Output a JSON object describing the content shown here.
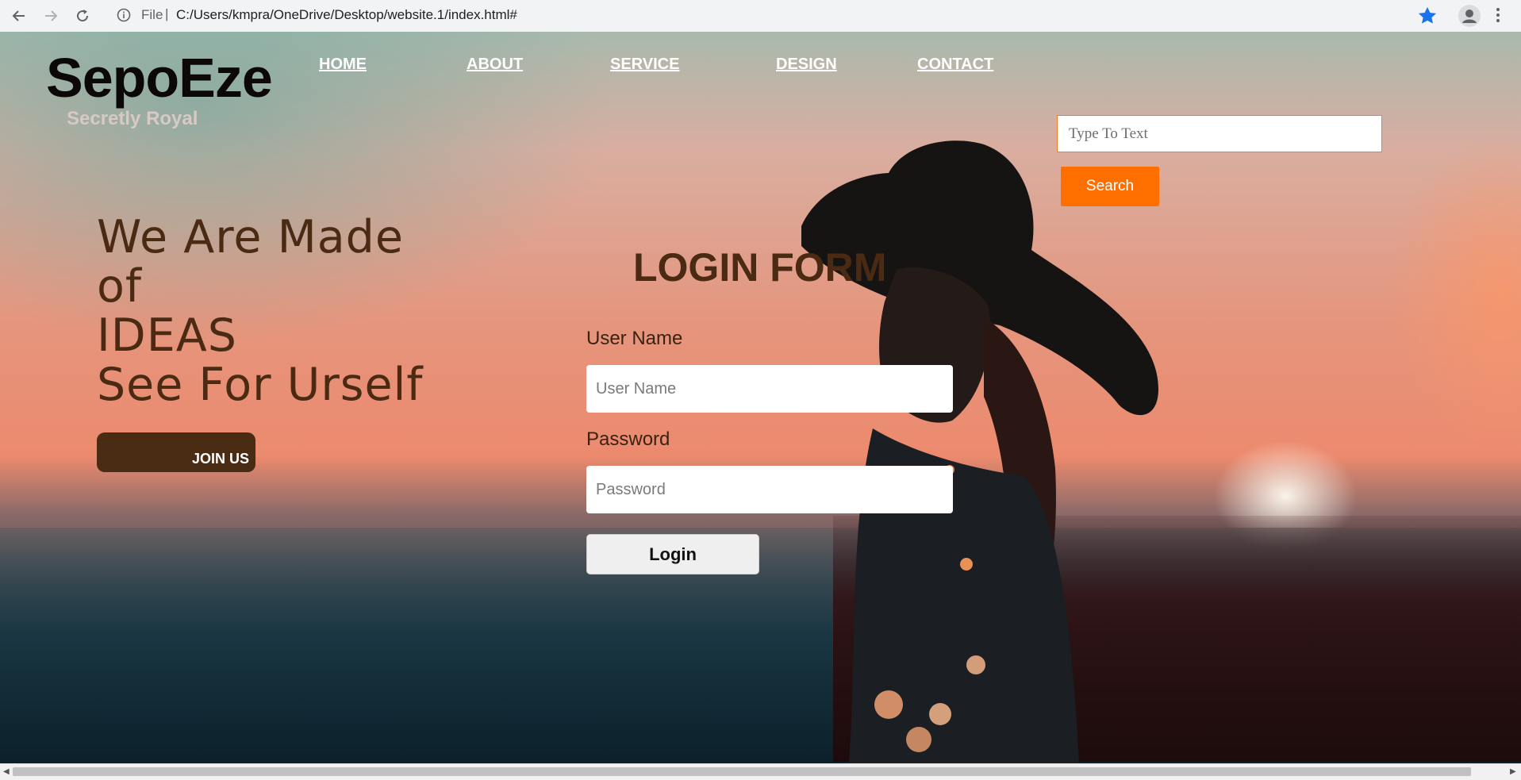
{
  "browser": {
    "scheme_label": "File",
    "url": "C:/Users/kmpra/OneDrive/Desktop/website.1/index.html#"
  },
  "site": {
    "logo": "SepoEze",
    "tagline": "Secretly Royal",
    "nav": [
      {
        "label": "HOME"
      },
      {
        "label": "ABOUT"
      },
      {
        "label": "SERVICE"
      },
      {
        "label": "DESIGN"
      },
      {
        "label": "CONTACT"
      }
    ],
    "search": {
      "placeholder": "Type To Text",
      "button_label": "Search"
    }
  },
  "hero": {
    "lines": [
      "We Are Made",
      "of",
      "IDEAS",
      "See For Urself"
    ],
    "join_label": "JOIN US"
  },
  "login": {
    "title": "LOGIN FORM",
    "username_label": "User Name",
    "username_placeholder": "User Name",
    "password_label": "Password",
    "password_placeholder": "Password",
    "submit_label": "Login"
  },
  "colors": {
    "accent": "#ff6f00",
    "heading_brown": "#4a2a12",
    "join_button": "#4a2c14",
    "bookmark_star": "#1a73e8"
  },
  "icons": [
    "back-arrow-icon",
    "forward-arrow-icon",
    "reload-icon",
    "info-icon",
    "bookmark-star-icon",
    "profile-icon",
    "kebab-menu-icon"
  ]
}
